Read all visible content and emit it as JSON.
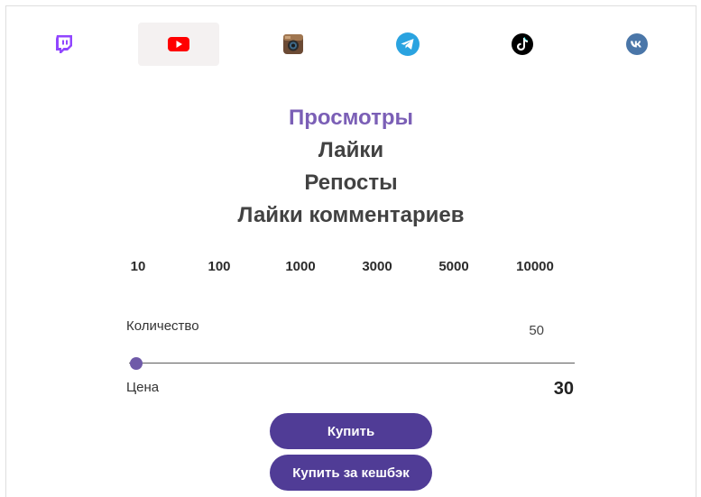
{
  "platforms": [
    {
      "icon": "twitch-icon",
      "color": "#9146ff",
      "active": false
    },
    {
      "icon": "youtube-icon",
      "color": "#ff0000",
      "active": true
    },
    {
      "icon": "instagram-icon",
      "color": "#8a5a3c",
      "active": false
    },
    {
      "icon": "telegram-icon",
      "color": "#2aa3e0",
      "active": false
    },
    {
      "icon": "tiktok-icon",
      "color": "#000000",
      "active": false
    },
    {
      "icon": "vk-icon",
      "color": "#4a76a8",
      "active": false
    }
  ],
  "services": {
    "items": [
      "Просмотры",
      "Лайки",
      "Репосты",
      "Лайки комментариев"
    ],
    "selected": "Просмотры"
  },
  "quantities": [
    "10",
    "100",
    "1000",
    "3000",
    "5000",
    "10000"
  ],
  "quantity": {
    "label": "Количество",
    "value": "50"
  },
  "price": {
    "label": "Цена",
    "value": "30"
  },
  "buttons": {
    "buy": "Купить",
    "buy_cashback": "Купить за кешбэк"
  },
  "colors": {
    "accent": "#503c96",
    "selected_text": "#7b5fb6",
    "active_tab_bg": "#f4f1f1"
  }
}
